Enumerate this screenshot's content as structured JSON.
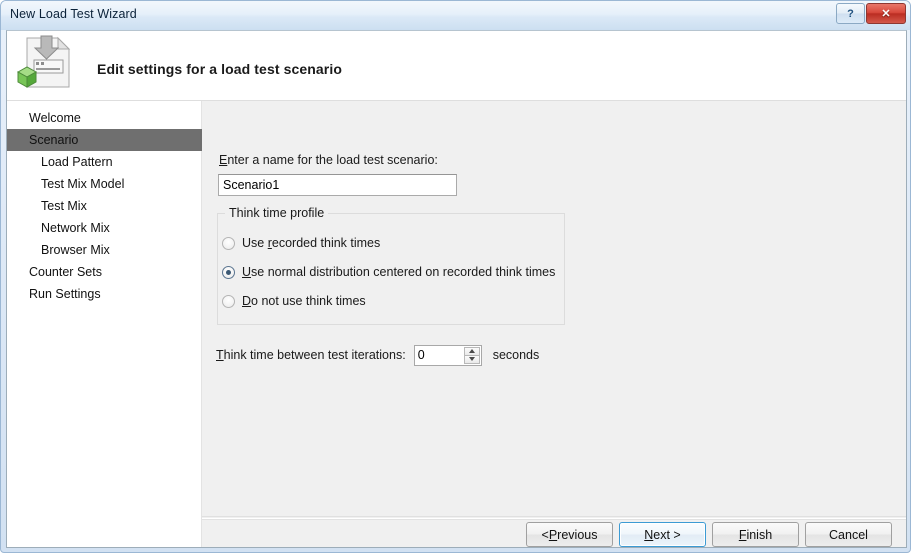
{
  "window": {
    "title": "New Load Test Wizard",
    "help_button": "?",
    "close_button": "✕"
  },
  "header": {
    "title": "Edit settings for a load test scenario",
    "icon": "load-test-document-icon"
  },
  "sidebar": {
    "items": [
      {
        "label": "Welcome",
        "level": 0,
        "selected": false
      },
      {
        "label": "Scenario",
        "level": 0,
        "selected": true
      },
      {
        "label": "Load Pattern",
        "level": 1,
        "selected": false
      },
      {
        "label": "Test Mix Model",
        "level": 1,
        "selected": false
      },
      {
        "label": "Test Mix",
        "level": 1,
        "selected": false
      },
      {
        "label": "Network Mix",
        "level": 1,
        "selected": false
      },
      {
        "label": "Browser Mix",
        "level": 1,
        "selected": false
      },
      {
        "label": "Counter Sets",
        "level": 0,
        "selected": false
      },
      {
        "label": "Run Settings",
        "level": 0,
        "selected": false
      }
    ]
  },
  "main": {
    "name_field": {
      "label_prefix": "",
      "label_accel": "E",
      "label_suffix": "nter a name for the load test scenario:",
      "value": "Scenario1",
      "placeholder": ""
    },
    "think_time_group": {
      "legend": "Think time profile",
      "options": [
        {
          "prefix": "Use ",
          "accel": "r",
          "suffix": "ecorded think times",
          "checked": false
        },
        {
          "prefix": "",
          "accel": "U",
          "suffix": "se normal distribution centered on recorded think times",
          "checked": true
        },
        {
          "prefix": "",
          "accel": "D",
          "suffix": "o not use think times",
          "checked": false
        }
      ]
    },
    "think_time_iterations": {
      "label_prefix": "",
      "label_accel": "T",
      "label_suffix": "hink time between test iterations:",
      "value": "0",
      "units": "seconds",
      "spin_up": "increment",
      "spin_down": "decrement"
    }
  },
  "footer": {
    "buttons": [
      {
        "prefix": "< ",
        "accel": "P",
        "suffix": "revious",
        "default": false
      },
      {
        "prefix": "",
        "accel": "N",
        "suffix": "ext >",
        "default": true
      },
      {
        "prefix": "",
        "accel": "F",
        "suffix": "inish",
        "default": false
      },
      {
        "prefix": "Cancel",
        "accel": "",
        "suffix": "",
        "default": false
      }
    ]
  },
  "colors": {
    "selection": "#6f6f6f",
    "panel": "#f0f0f0",
    "default_button_border": "#3c9bd4",
    "close_button": "#bb2d22",
    "radio_dot": "#3b5873"
  }
}
